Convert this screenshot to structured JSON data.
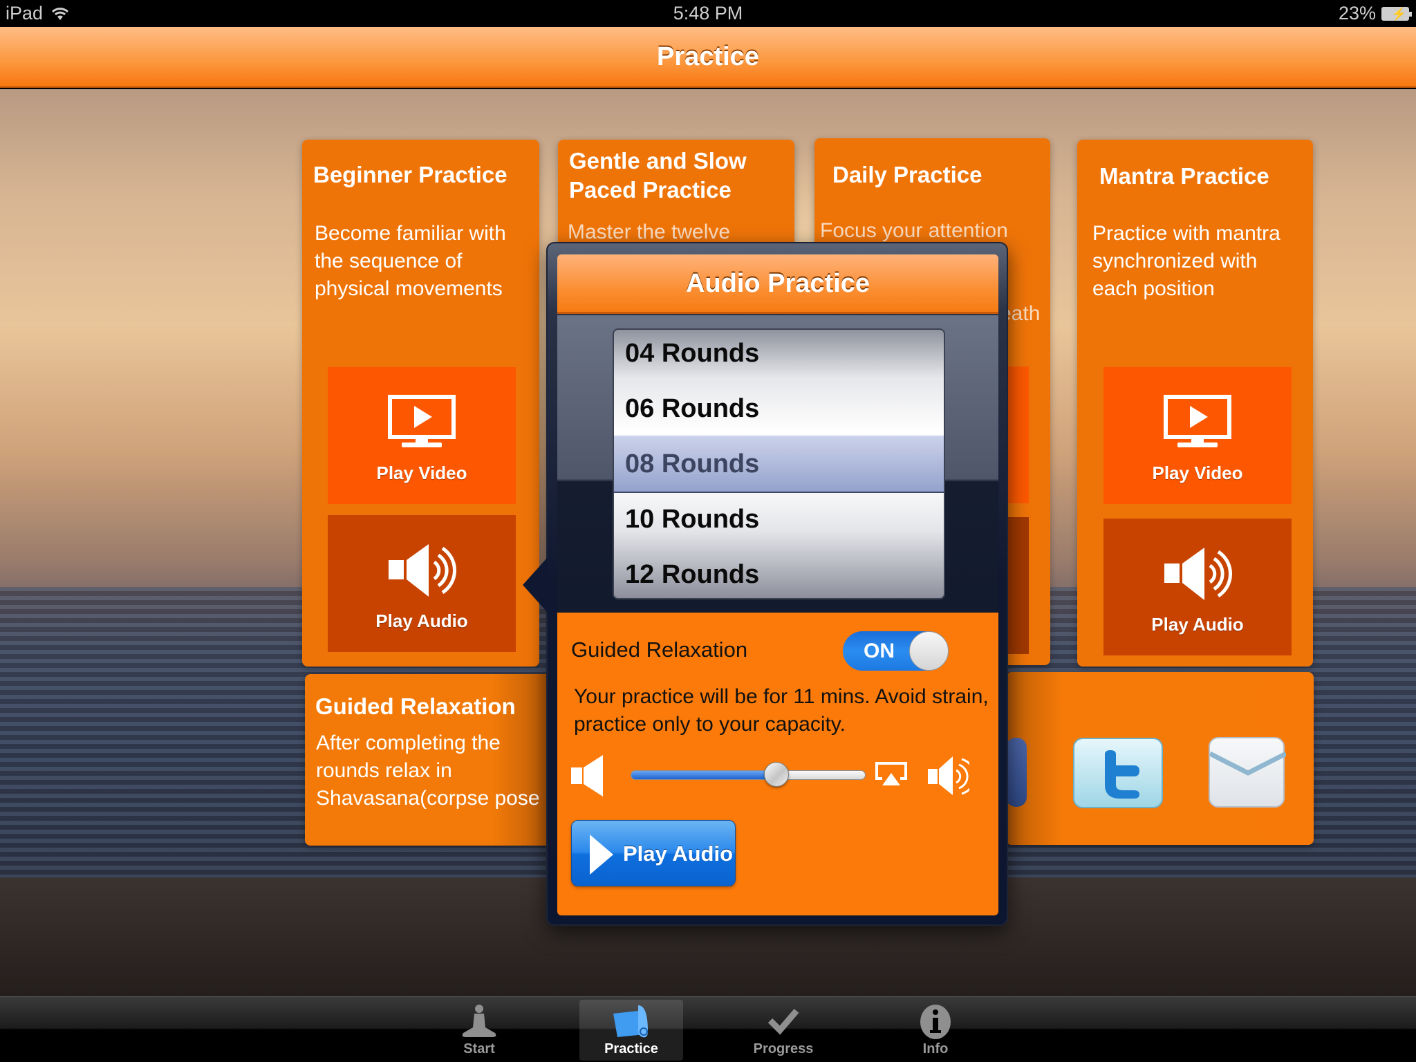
{
  "status_bar": {
    "device": "iPad",
    "time": "5:48 PM",
    "battery": "23%"
  },
  "nav": {
    "title": "Practice"
  },
  "cards": [
    {
      "title": "Beginner Practice",
      "description": "Become familiar with the sequence of physical movements",
      "video_label": "Play Video",
      "audio_label": "Play Audio"
    },
    {
      "title": "Gentle and Slow Paced Practice",
      "description": "Master the twelve"
    },
    {
      "title": "Daily Practice",
      "description": "Focus your attention",
      "description_tail": "eath"
    },
    {
      "title": "Mantra Practice",
      "description": "Practice with mantra synchronized with each position",
      "video_label": "Play Video",
      "audio_label": "Play Audio"
    }
  ],
  "relaxation_card": {
    "title": "Guided Relaxation",
    "description": "After completing the rounds  relax in Shavasana(corpse pose"
  },
  "social": {
    "icons": [
      "facebook-icon",
      "twitter-icon",
      "mail-icon"
    ]
  },
  "popover": {
    "title": "Audio Practice",
    "rounds_options": [
      "04 Rounds",
      "06 Rounds",
      "08 Rounds",
      "10 Rounds",
      "12 Rounds"
    ],
    "selected_round": "08 Rounds",
    "guided_relaxation_label": "Guided Relaxation",
    "guided_relaxation_state": "ON",
    "message": "Your practice will be for 11 mins. Avoid strain, practice only to your capacity.",
    "volume_fraction": 0.62,
    "play_button_label": "Play Audio"
  },
  "tabbar": {
    "tabs": [
      {
        "label": "Start",
        "icon": "meditation-figure-icon",
        "active": false
      },
      {
        "label": "Practice",
        "icon": "yoga-mat-icon",
        "active": true
      },
      {
        "label": "Progress",
        "icon": "checkmark-icon",
        "active": false
      },
      {
        "label": "Info",
        "icon": "info-icon",
        "active": false
      }
    ]
  },
  "colors": {
    "accent_orange": "#ef7408",
    "video_tile": "#fd5801",
    "audio_tile": "#c84300",
    "switch_blue": "#2b8df0",
    "play_button_blue": "#1d79e2"
  }
}
